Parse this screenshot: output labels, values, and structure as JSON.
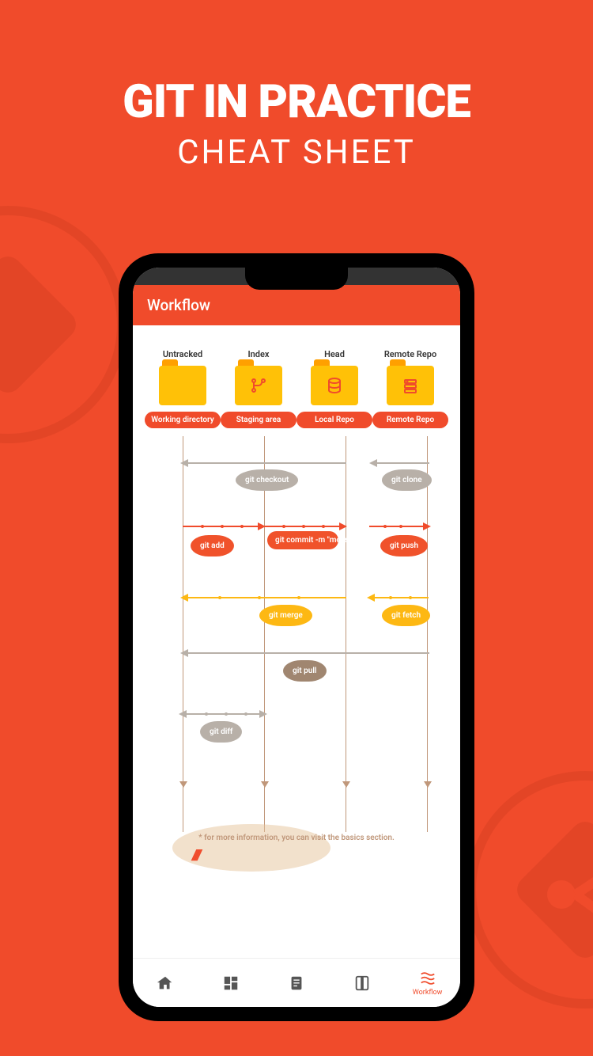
{
  "header": {
    "title": "GIT IN PRACTICE",
    "subtitle": "CHEAT SHEET"
  },
  "appbar": {
    "title": "Workflow"
  },
  "columns": [
    {
      "top": "Untracked",
      "badge": "Working directory",
      "icon": "folder"
    },
    {
      "top": "Index",
      "badge": "Staging area",
      "icon": "branch"
    },
    {
      "top": "Head",
      "badge": "Local Repo",
      "icon": "database"
    },
    {
      "top": "Remote Repo",
      "badge": "Remote Repo",
      "icon": "server"
    }
  ],
  "commands": {
    "checkout": "git checkout",
    "clone": "git clone",
    "add": "git add",
    "commit": "git commit -m \"message\"",
    "push": "git push",
    "merge": "git merge",
    "fetch": "git fetch",
    "pull": "git pull",
    "diff": "git diff"
  },
  "footer": {
    "note": "* for more information, you can visit the basics section."
  },
  "nav": {
    "workflow": "Workflow"
  }
}
